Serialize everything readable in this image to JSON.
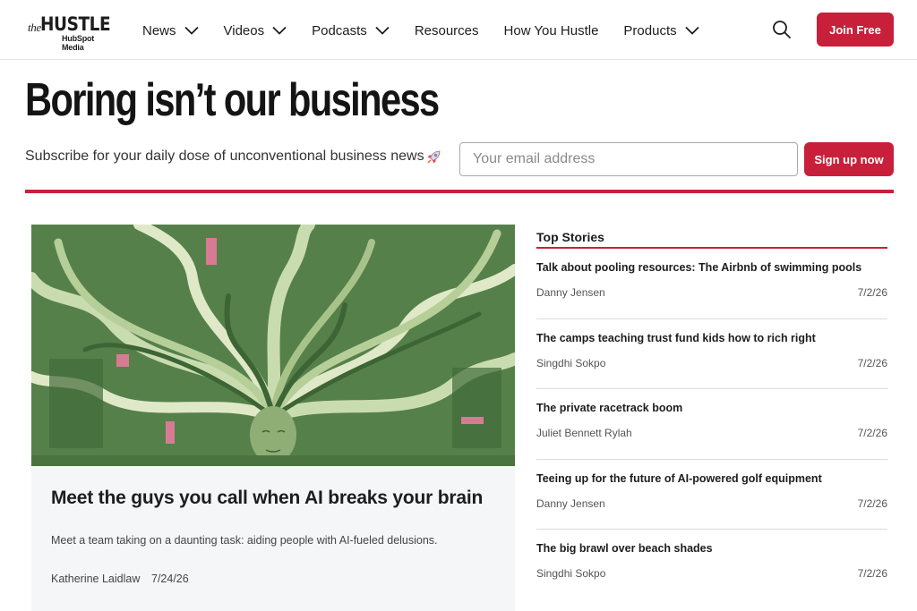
{
  "brand": {
    "logo_the": "the",
    "logo_hustle": "HUSTLE",
    "logo_sub": "HubSpot Media",
    "accent": "#c8203a"
  },
  "nav": {
    "items": [
      {
        "label": "News",
        "dropdown": true
      },
      {
        "label": "Videos",
        "dropdown": true
      },
      {
        "label": "Podcasts",
        "dropdown": true
      },
      {
        "label": "Resources",
        "dropdown": false
      },
      {
        "label": "How You Hustle",
        "dropdown": false
      },
      {
        "label": "Products",
        "dropdown": true
      }
    ],
    "search_icon": "search-icon",
    "join_label": "Join Free"
  },
  "hero": {
    "title": "Boring isn’t our business",
    "subscribe_text": "Subscribe for your daily dose of unconventional business news",
    "rocket_icon": "rocket-icon",
    "email_placeholder": "Your email address",
    "email_value": "",
    "signup_label": "Sign up now"
  },
  "featured": {
    "title": "Meet the guys you call when AI breaks your brain",
    "description": "Meet a team taking on a daunting task: aiding people with AI-fueled delusions.",
    "author": "Katherine Laidlaw",
    "date": "7/24/26"
  },
  "top_stories": {
    "heading": "Top Stories",
    "items": [
      {
        "title": "Talk about pooling resources: The Airbnb of swimming pools",
        "author": "Danny Jensen",
        "date": "7/2/26"
      },
      {
        "title": "The camps teaching trust fund kids how to rich right",
        "author": "Singdhi Sokpo",
        "date": "7/2/26"
      },
      {
        "title": "The private racetrack boom",
        "author": "Juliet Bennett Rylah",
        "date": "7/2/26"
      },
      {
        "title": "Teeing up for the future of AI-powered golf equipment",
        "author": "Danny Jensen",
        "date": "7/2/26"
      },
      {
        "title": "The big brawl over beach shades",
        "author": "Singdhi Sokpo",
        "date": "7/2/26"
      }
    ]
  }
}
